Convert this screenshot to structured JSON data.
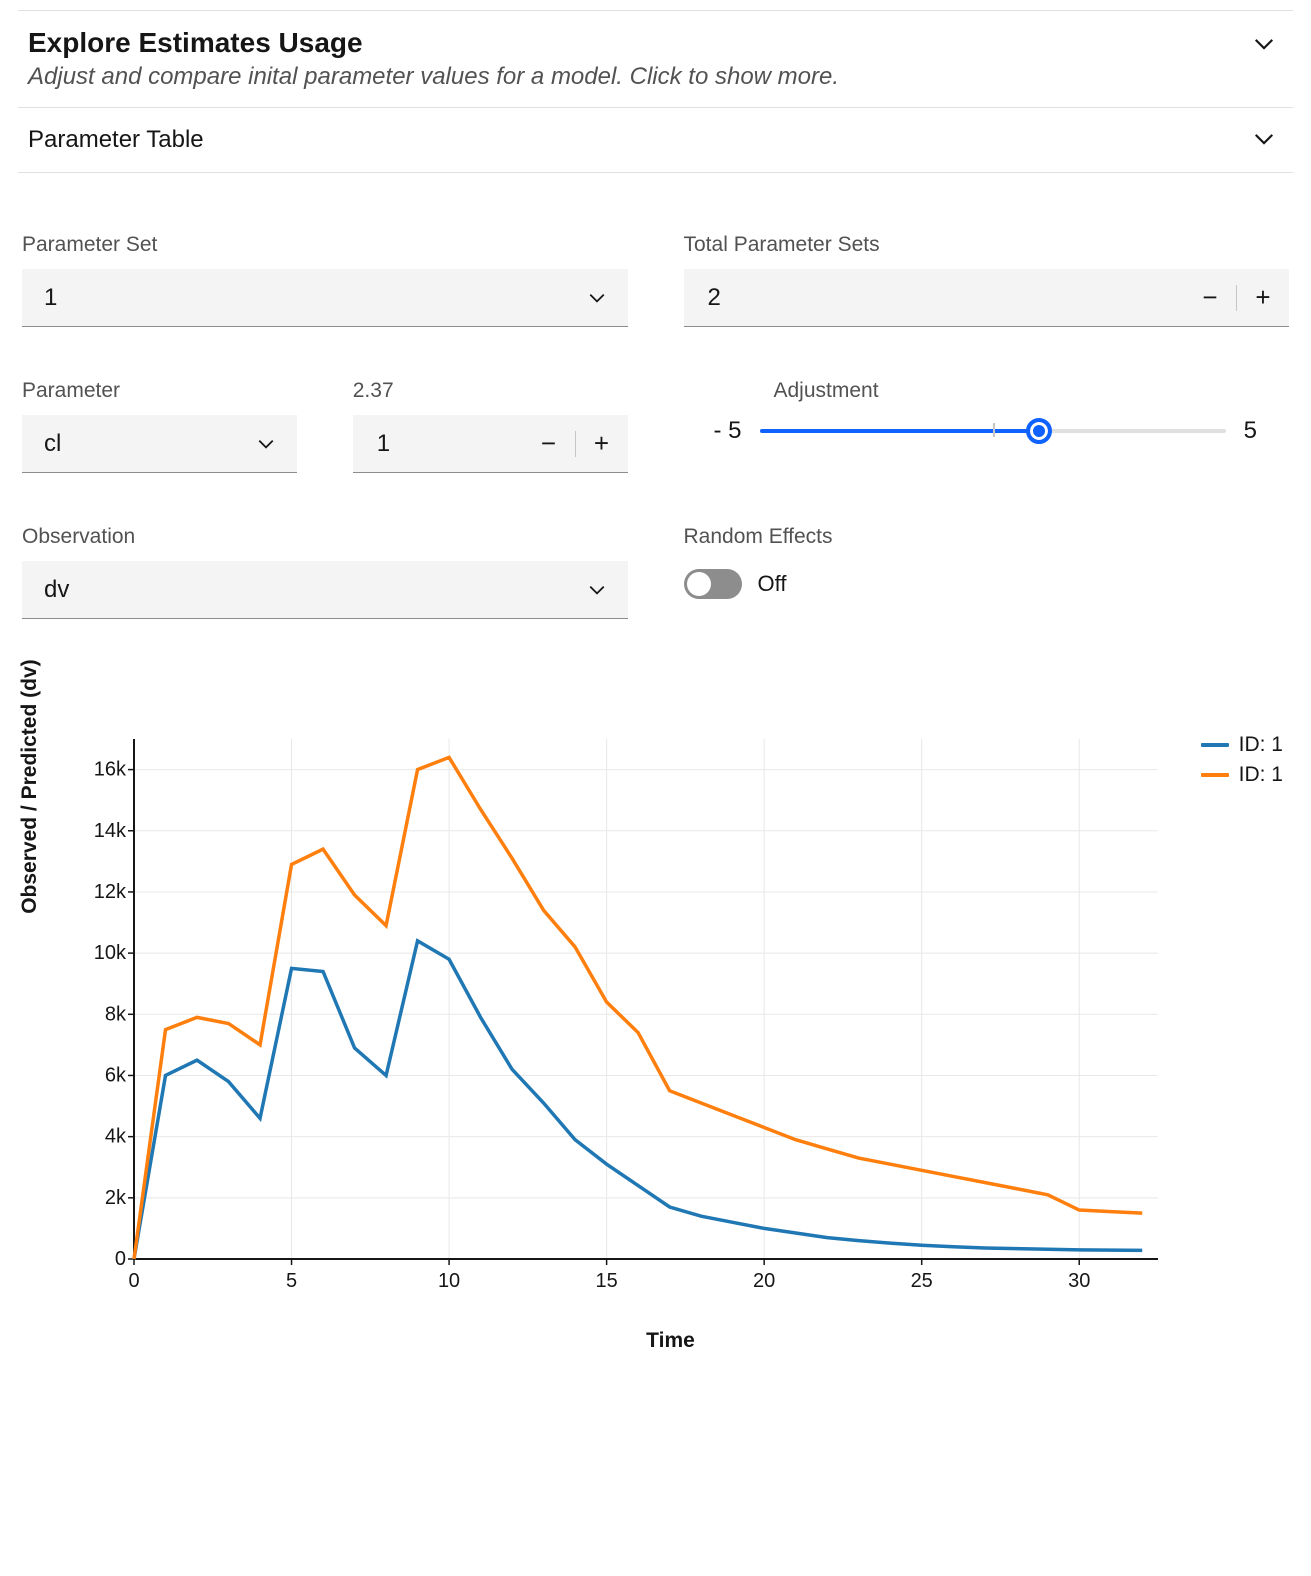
{
  "accordion": {
    "explore_title": "Explore Estimates Usage",
    "explore_sub": "Adjust and compare inital parameter values for a model. Click to show more.",
    "param_table_title": "Parameter Table"
  },
  "controls": {
    "parameter_set_label": "Parameter Set",
    "parameter_set_value": "1",
    "total_sets_label": "Total Parameter Sets",
    "total_sets_value": "2",
    "parameter_label": "Parameter",
    "parameter_value": "cl",
    "param_numeric_label": "2.37",
    "param_numeric_value": "1",
    "adjustment_label": "Adjustment",
    "adjustment_min": "- 5",
    "adjustment_max": "5",
    "adjustment_value": 1,
    "observation_label": "Observation",
    "observation_value": "dv",
    "random_effects_label": "Random Effects",
    "random_effects_state": "Off"
  },
  "chart_data": {
    "type": "line",
    "title": "",
    "xlabel": "Time",
    "ylabel": "Observed / Predicted (dv)",
    "xlim": [
      0,
      32.5
    ],
    "ylim": [
      0,
      17000
    ],
    "x_ticks": [
      0,
      5,
      10,
      15,
      20,
      25,
      30
    ],
    "y_ticks": [
      0,
      2000,
      4000,
      6000,
      8000,
      10000,
      12000,
      14000,
      16000
    ],
    "y_tick_labels": [
      "0",
      "2k",
      "4k",
      "6k",
      "8k",
      "10k",
      "12k",
      "14k",
      "16k"
    ],
    "legend_position": "right",
    "series": [
      {
        "name": "ID: 1",
        "color": "#1f77b4",
        "x": [
          0,
          1,
          2,
          3,
          4,
          5,
          6,
          7,
          8,
          9,
          10,
          11,
          12,
          13,
          14,
          15,
          16,
          17,
          18,
          19,
          20,
          21,
          22,
          23,
          24,
          25,
          26,
          27,
          28,
          29,
          30,
          31,
          32
        ],
        "values": [
          0,
          6000,
          6500,
          5800,
          4600,
          9500,
          9400,
          6900,
          6000,
          10400,
          9800,
          7900,
          6200,
          5100,
          3900,
          3100,
          2400,
          1700,
          1400,
          1200,
          1000,
          850,
          700,
          600,
          520,
          450,
          400,
          360,
          340,
          320,
          300,
          290,
          280
        ]
      },
      {
        "name": "ID: 1",
        "color": "#ff7f0e",
        "x": [
          0,
          1,
          2,
          3,
          4,
          5,
          6,
          7,
          8,
          9,
          10,
          11,
          12,
          13,
          14,
          15,
          16,
          17,
          18,
          19,
          20,
          21,
          22,
          23,
          24,
          25,
          26,
          27,
          28,
          29,
          30,
          31,
          32
        ],
        "values": [
          0,
          7500,
          7900,
          7700,
          7000,
          12900,
          13400,
          11900,
          10900,
          16000,
          16400,
          14700,
          13100,
          11400,
          10200,
          8400,
          7400,
          5500,
          5100,
          4700,
          4300,
          3900,
          3600,
          3300,
          3100,
          2900,
          2700,
          2500,
          2300,
          2100,
          1600,
          1550,
          1500
        ]
      }
    ]
  }
}
